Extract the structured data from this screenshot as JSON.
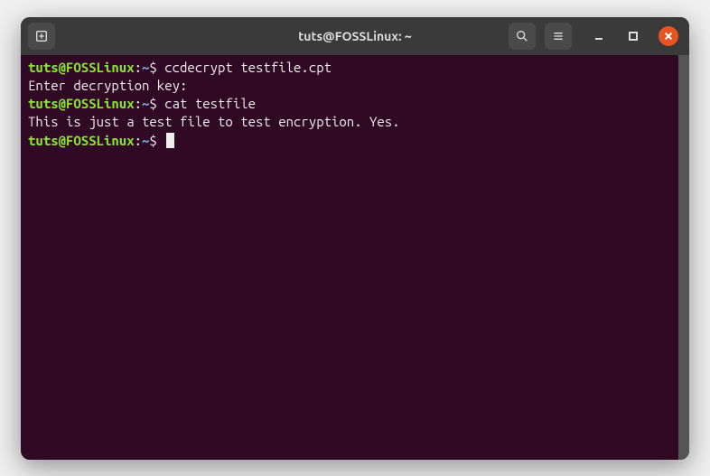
{
  "titlebar": {
    "title": "tuts@FOSSLinux: ~"
  },
  "prompt": {
    "user_host": "tuts@FOSSLinux",
    "colon": ":",
    "path": "~",
    "dollar": "$ "
  },
  "lines": {
    "cmd1": "ccdecrypt testfile.cpt",
    "out1": "Enter decryption key:",
    "cmd2": "cat testfile",
    "out2": "This is just a test file to test encryption. Yes."
  }
}
